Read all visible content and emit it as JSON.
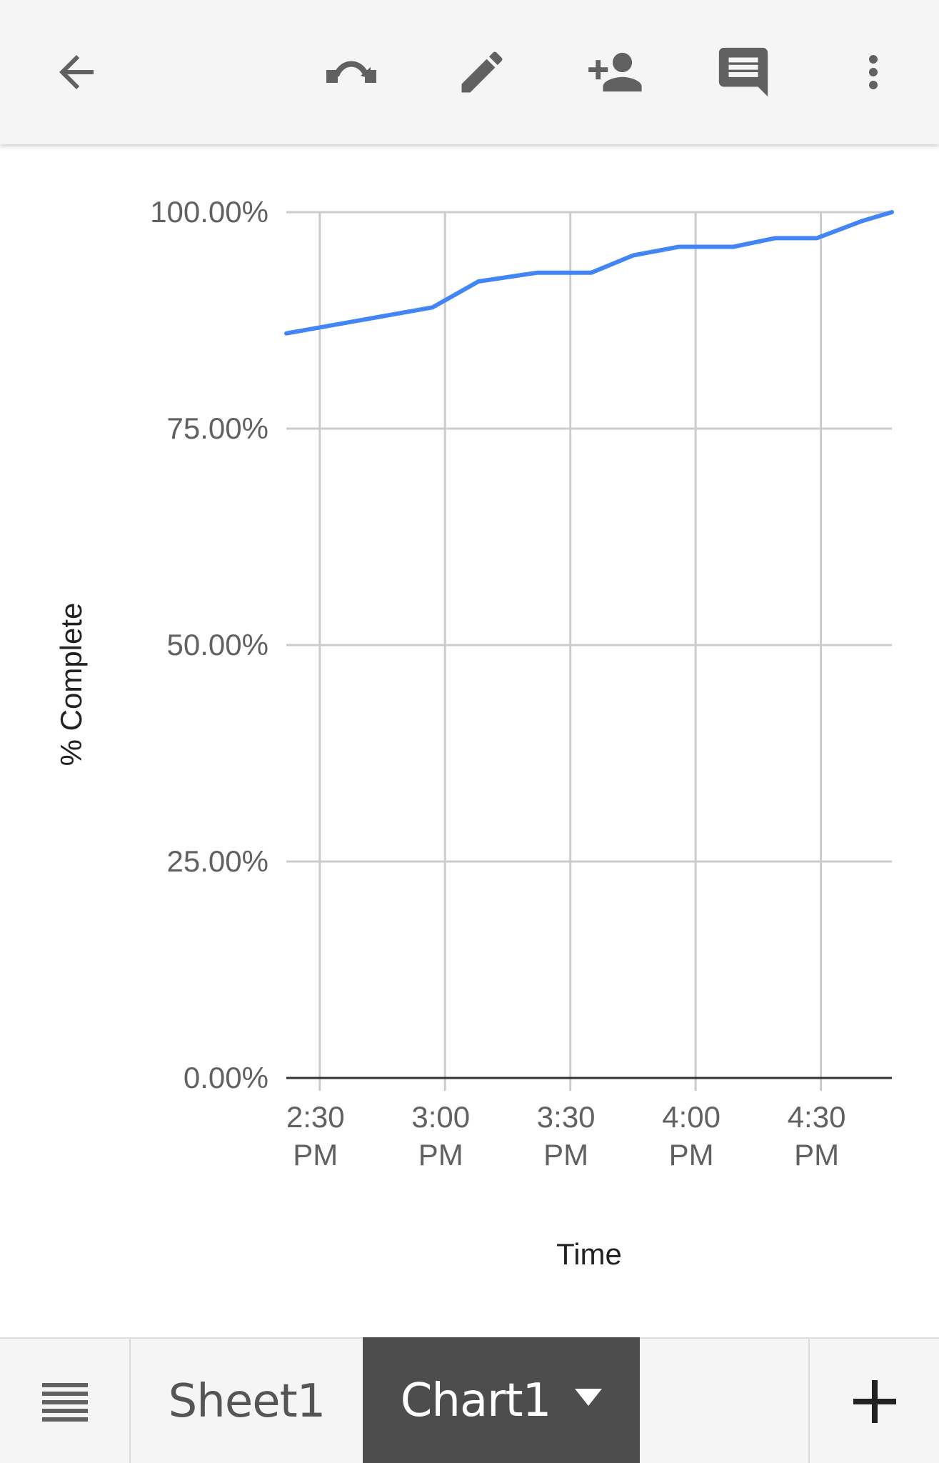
{
  "toolbar": {
    "icons": [
      "back-arrow-icon",
      "edit-mode-icon",
      "pencil-icon",
      "add-person-icon",
      "comment-icon",
      "more-vert-icon"
    ]
  },
  "tabs": {
    "sheet1_label": "Sheet1",
    "chart1_label": "Chart1",
    "active": "Chart1"
  },
  "colors": {
    "line": "#4285f4",
    "grid": "#cccccc",
    "axis": "#333333",
    "toolbar_bg": "#f5f5f5",
    "active_tab_bg": "#4d4d4d"
  },
  "chart_data": {
    "type": "line",
    "title": "",
    "xlabel": "Time",
    "ylabel": "% Complete",
    "ylim": [
      0,
      100
    ],
    "yticks": [
      "0.00%",
      "25.00%",
      "50.00%",
      "75.00%",
      "100.00%"
    ],
    "ytick_values": [
      0,
      25,
      50,
      75,
      100
    ],
    "xlim": [
      "2:22 PM",
      "4:47 PM"
    ],
    "xticks": [
      {
        "time": "2:30 PM",
        "line1": "2:30",
        "line2": "PM"
      },
      {
        "time": "3:00 PM",
        "line1": "3:00",
        "line2": "PM"
      },
      {
        "time": "3:30 PM",
        "line1": "3:30",
        "line2": "PM"
      },
      {
        "time": "4:00 PM",
        "line1": "4:00",
        "line2": "PM"
      },
      {
        "time": "4:30 PM",
        "line1": "4:30",
        "line2": "PM"
      }
    ],
    "grid": true,
    "series": [
      {
        "x": [
          "2:22 PM",
          "2:57 PM",
          "3:08 PM",
          "3:22 PM",
          "3:35 PM",
          "3:45 PM",
          "3:56 PM",
          "4:09 PM",
          "4:19 PM",
          "4:29 PM",
          "4:40 PM",
          "4:47 PM"
        ],
        "y": [
          86,
          89,
          92,
          93,
          93,
          95,
          96,
          96,
          97,
          97,
          99,
          100
        ]
      }
    ]
  }
}
